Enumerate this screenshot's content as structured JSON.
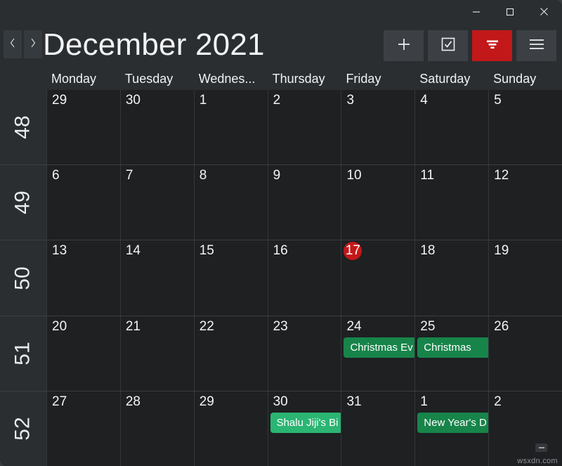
{
  "window": {
    "titlebar": {
      "minimize_label": "Minimize",
      "maximize_label": "Maximize",
      "close_label": "Close"
    },
    "background_color": "#2b2e31"
  },
  "header": {
    "month_title": "December 2021",
    "prev_label": "‹",
    "next_label": "›",
    "nav": [
      {
        "name": "previous-month",
        "icon": "chevron-left-icon"
      },
      {
        "name": "next-month",
        "icon": "chevron-right-icon"
      }
    ],
    "tools": [
      {
        "name": "add-event-button",
        "icon": "plus-icon",
        "label": "Add",
        "accent": false
      },
      {
        "name": "tasks-button",
        "icon": "checkbox-icon",
        "label": "Tasks",
        "accent": false
      },
      {
        "name": "filter-button",
        "icon": "filter-icon",
        "label": "Filter",
        "accent": true
      },
      {
        "name": "menu-button",
        "icon": "hamburger-icon",
        "label": "Menu",
        "accent": false
      }
    ],
    "accent_color": "#c2181a"
  },
  "weekdays": [
    "Monday",
    "Tuesday",
    "Wednes...",
    "Thursday",
    "Friday",
    "Saturday",
    "Sunday"
  ],
  "calendar": {
    "today_color": "#c2181a",
    "weeks": [
      {
        "week_number": "48",
        "days": [
          {
            "date": "29",
            "today": false,
            "events": []
          },
          {
            "date": "30",
            "today": false,
            "events": []
          },
          {
            "date": "1",
            "today": false,
            "events": []
          },
          {
            "date": "2",
            "today": false,
            "events": []
          },
          {
            "date": "3",
            "today": false,
            "events": []
          },
          {
            "date": "4",
            "today": false,
            "events": []
          },
          {
            "date": "5",
            "today": false,
            "events": []
          }
        ]
      },
      {
        "week_number": "49",
        "days": [
          {
            "date": "6",
            "today": false,
            "events": []
          },
          {
            "date": "7",
            "today": false,
            "events": []
          },
          {
            "date": "8",
            "today": false,
            "events": []
          },
          {
            "date": "9",
            "today": false,
            "events": []
          },
          {
            "date": "10",
            "today": false,
            "events": []
          },
          {
            "date": "11",
            "today": false,
            "events": []
          },
          {
            "date": "12",
            "today": false,
            "events": []
          }
        ]
      },
      {
        "week_number": "50",
        "days": [
          {
            "date": "13",
            "today": false,
            "events": []
          },
          {
            "date": "14",
            "today": false,
            "events": []
          },
          {
            "date": "15",
            "today": false,
            "events": []
          },
          {
            "date": "16",
            "today": false,
            "events": []
          },
          {
            "date": "17",
            "today": true,
            "events": []
          },
          {
            "date": "18",
            "today": false,
            "events": []
          },
          {
            "date": "19",
            "today": false,
            "events": []
          }
        ]
      },
      {
        "week_number": "51",
        "days": [
          {
            "date": "20",
            "today": false,
            "events": []
          },
          {
            "date": "21",
            "today": false,
            "events": []
          },
          {
            "date": "22",
            "today": false,
            "events": []
          },
          {
            "date": "23",
            "today": false,
            "events": []
          },
          {
            "date": "24",
            "today": false,
            "events": [
              {
                "title": "Christmas Ev",
                "color": "#17844a"
              }
            ]
          },
          {
            "date": "25",
            "today": false,
            "events": [
              {
                "title": "Christmas",
                "color": "#17844a"
              }
            ]
          },
          {
            "date": "26",
            "today": false,
            "events": []
          }
        ]
      },
      {
        "week_number": "52",
        "days": [
          {
            "date": "27",
            "today": false,
            "events": []
          },
          {
            "date": "28",
            "today": false,
            "events": []
          },
          {
            "date": "29",
            "today": false,
            "events": []
          },
          {
            "date": "30",
            "today": false,
            "events": [
              {
                "title": "Shalu Jiji's Bi",
                "color": "#2bb573"
              }
            ]
          },
          {
            "date": "31",
            "today": false,
            "events": []
          },
          {
            "date": "1",
            "today": false,
            "events": [
              {
                "title": "New Year's D",
                "color": "#17844a"
              }
            ]
          },
          {
            "date": "2",
            "today": false,
            "events": []
          }
        ]
      }
    ]
  },
  "footer": {
    "watermark": "wsxdn.com",
    "resize_label": "Resize"
  }
}
